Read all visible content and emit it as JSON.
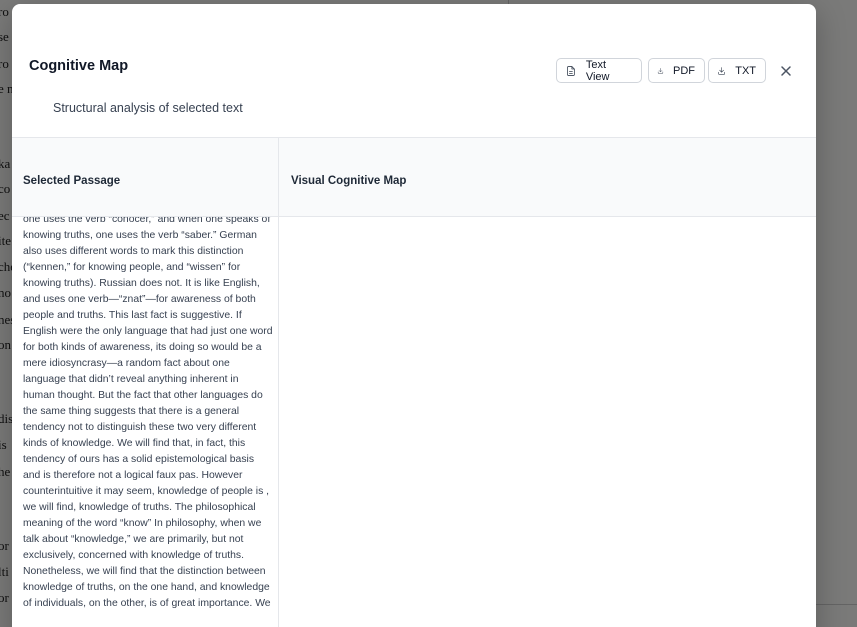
{
  "background": {
    "fragments": [
      "ro",
      "se",
      "ro",
      "e n",
      "ka",
      "co",
      "ec",
      "ite",
      "che",
      "no",
      "nes",
      "on",
      "disc",
      "is",
      "he",
      "or",
      "lti",
      "or"
    ]
  },
  "modal": {
    "title": "Cognitive Map",
    "subtitle": "Structural analysis of selected text",
    "buttons": {
      "text_view": "Text View",
      "pdf": "PDF",
      "txt": "TXT"
    },
    "left_panel": {
      "title": "Selected Passage",
      "text": "one uses the verb “conocer,” and when one speaks of knowing truths, one uses the verb “saber.” German also uses different words to mark this distinction (“kennen,” for knowing people, and “wissen” for knowing truths). Russian does not. It is like English, and uses one verb—“znat”—for awareness of both people and truths.  This last fact is suggestive. If English were the only language that had just one word for both kinds of awareness, its doing so would be a mere idiosyncrasy—a random fact about one language that didn’t reveal anything inherent in human thought. But the fact that other languages do the same thing suggests that there is a general tendency not to distinguish these two very different kinds of knowledge. We will find that, in fact, this tendency of ours has a solid epistemological basis and is therefore not a logical faux pas. However counterintuitive it may seem, knowledge of people is , we will find, knowledge of truths.  The philosophical meaning of the word “know”  In philosophy, when we talk about “knowledge,” we are primarily, but not exclusively, concerned with knowledge of truths. Nonetheless, we will find that the distinction between knowledge of truths, on the one hand, and knowledge of individuals, on the other, is of great importance.  We"
    },
    "right_panel": {
      "title": "Visual Cognitive Map"
    }
  }
}
